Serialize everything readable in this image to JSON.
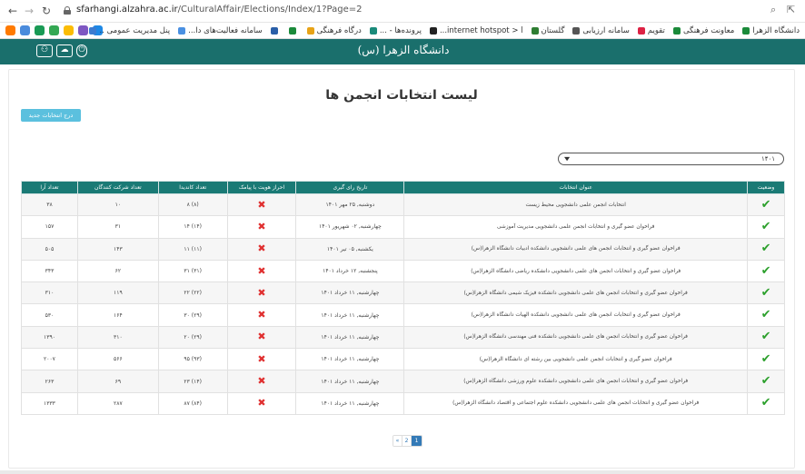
{
  "browser": {
    "url_host": "sfarhangi.alzahra.ac.ir",
    "url_path": "/CulturalAffair/Elections/Index/1?Page=2",
    "bookmarks": [
      {
        "label": "پنل مدیریت عمومی ..",
        "color": "#3b7bd0"
      },
      {
        "label": "سامانه فعالیت‌های دا...",
        "color": "#4a90e2"
      },
      {
        "label": "",
        "color": "#2a5fa8"
      },
      {
        "label": "",
        "color": "#1b8a3a"
      },
      {
        "label": "درگاه فرهنگی",
        "color": "#e8a317"
      },
      {
        "label": "پرونده‌ها - ...",
        "color": "#1a8a7a"
      },
      {
        "label": "internet hotspot > l...",
        "color": "#222222"
      },
      {
        "label": "گلستان",
        "color": "#2e7d32"
      },
      {
        "label": "سامانه ارزیابی",
        "color": "#555555"
      },
      {
        "label": "تقویم",
        "color": "#d24"
      },
      {
        "label": "معاونت فرهنگی",
        "color": "#1b8a3a"
      },
      {
        "label": "دانشگاه الزهرا",
        "color": "#1b8a3a"
      }
    ],
    "extension_colors": [
      "#ff7a00",
      "#4a8bdc",
      "#1a9a55",
      "#34a853",
      "#fbbc04",
      "#7e57c2",
      "#1e88e5"
    ]
  },
  "site": {
    "logo_text": "دانشگاه الزهرا (س)"
  },
  "page": {
    "title": "لیست انتخابات انجمن ها",
    "new_button": "درج انتخابات جدید",
    "year_select_value": "۱۴۰۱"
  },
  "table": {
    "headers": [
      "وضعیت",
      "عنوان انتخابات",
      "تاریخ رای گیری",
      "احراز هویت با پیامک",
      "تعداد کاندیدا",
      "تعداد شرکت کنندگان",
      "تعداد آرا"
    ],
    "rows": [
      {
        "title": "انتخابات انجمن علمی دانشجویی محیط زیست",
        "date": "دوشنبه, ۲۵ مهر ۱۴۰۱",
        "candidates": "(۸) ۸",
        "participants": "۱۰",
        "votes": "۳۸"
      },
      {
        "title": "فراخوان عضو گیری و انتخابات انجمن علمی دانشجویی مدیریت آموزشی",
        "date": "چهارشنبه, ۰۲ شهریور ۱۴۰۱",
        "candidates": "(۱۴) ۱۴",
        "participants": "۳۱",
        "votes": "۱۵۷"
      },
      {
        "title": "فراخوان عضو گیری و انتخابات انجمن های علمی دانشجویی دانشکده ادبیات دانشگاه الزهرا(س)",
        "date": "یکشنبه, ۰۵ تیر ۱۴۰۱",
        "candidates": "(۱۱) ۱۱",
        "participants": "۱۴۳",
        "votes": "۵۰۵"
      },
      {
        "title": "فراخوان عضو گیری و انتخابات انجمن های علمی دانشجویی دانشکده ریاضی دانشگاه الزهرا(س)",
        "date": "پنجشنبه, ۱۲ خرداد ۱۴۰۱",
        "candidates": "(۳۱) ۳۱",
        "participants": "۶۲",
        "votes": "۳۴۳"
      },
      {
        "title": "فراخوان عضو گیری و انتخابات انجمن های علمی دانشجویی دانشکده فیزیک شیمی دانشگاه الزهرا(س)",
        "date": "چهارشنبه, ۱۱ خرداد ۱۴۰۱",
        "candidates": "(۲۲) ۲۲",
        "participants": "۱۱۹",
        "votes": "۳۱۰"
      },
      {
        "title": "فراخوان عضو گیری و انتخابات انجمن های علمی دانشجویی دانشکده الهیات دانشگاه الزهرا(س)",
        "date": "چهارشنبه, ۱۱ خرداد ۱۴۰۱",
        "candidates": "(۲۹) ۳۰",
        "participants": "۱۶۴",
        "votes": "۵۳۰"
      },
      {
        "title": "فراخوان عضو گیری و انتخابات انجمن های علمی دانشجویی دانشکده فنی مهندسی دانشگاه الزهرا(س)",
        "date": "چهارشنبه, ۱۱ خرداد ۱۴۰۱",
        "candidates": "(۲۹) ۲۰",
        "participants": "۳۱۰",
        "votes": "۱۳۹۰"
      },
      {
        "title": "فراخوان عضو گیری و انتخابات انجمن علمی دانشجویی بین رشته ای دانشگاه الزهرا(س)",
        "date": "چهارشنبه, ۱۱ خرداد ۱۴۰۱",
        "candidates": "(۹۳) ۹۵",
        "participants": "۵۶۶",
        "votes": "۲۰۰۷"
      },
      {
        "title": "فراخوان عضو گیری و انتخابات انجمن های علمی دانشجویی دانشکده علوم ورزشی دانشگاه الزهرا(س)",
        "date": "چهارشنبه, ۱۱ خرداد ۱۴۰۱",
        "candidates": "(۱۴) ۲۳",
        "participants": "۶۹",
        "votes": "۲۶۳"
      },
      {
        "title": "فراخوان عضو گیری و انتخابات انجمن های علمی دانشجویی دانشکده علوم اجتماعی و اقتصاد دانشگاه الزهرا(س)",
        "date": "چهارشنبه, ۱۱ خرداد ۱۴۰۱",
        "candidates": "(۸۴) ۸۷",
        "participants": "۲۸۷",
        "votes": "۱۳۳۳"
      }
    ]
  },
  "pagination": {
    "prev": "«",
    "pages": [
      "2",
      "1"
    ],
    "active": "1"
  },
  "colors": {
    "header_teal": "#1a6f6c",
    "table_header": "#1a7a75",
    "button_info": "#5bc0de",
    "check_green": "#2ca02c",
    "cross_red": "#e03030"
  }
}
